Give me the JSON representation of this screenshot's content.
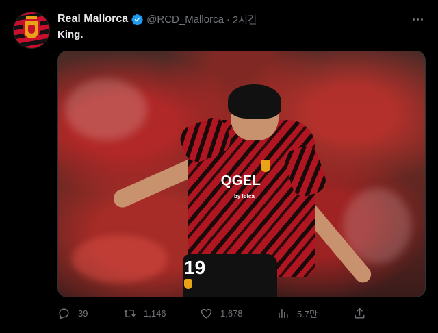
{
  "tweet": {
    "author_name": "Real Mallorca",
    "handle": "@RCD_Mallorca",
    "separator": "·",
    "time": "2시간",
    "text": "King.",
    "media": {
      "jersey_sponsor": "QGEL",
      "jersey_sponsor_sub": "by loica",
      "jersey_number": "19"
    }
  },
  "actions": {
    "replies": "39",
    "retweets": "1,146",
    "likes": "1,678",
    "views": "5.7만"
  },
  "icons": {
    "verified": "verified-badge-icon",
    "more": "more-icon",
    "reply": "reply-icon",
    "retweet": "retweet-icon",
    "like": "heart-icon",
    "views": "views-icon",
    "share": "share-icon"
  },
  "colors": {
    "background": "#000000",
    "text_primary": "#e7e9ea",
    "text_secondary": "#71767b",
    "verified": "#1d9bf0",
    "club_red": "#c8102e"
  }
}
